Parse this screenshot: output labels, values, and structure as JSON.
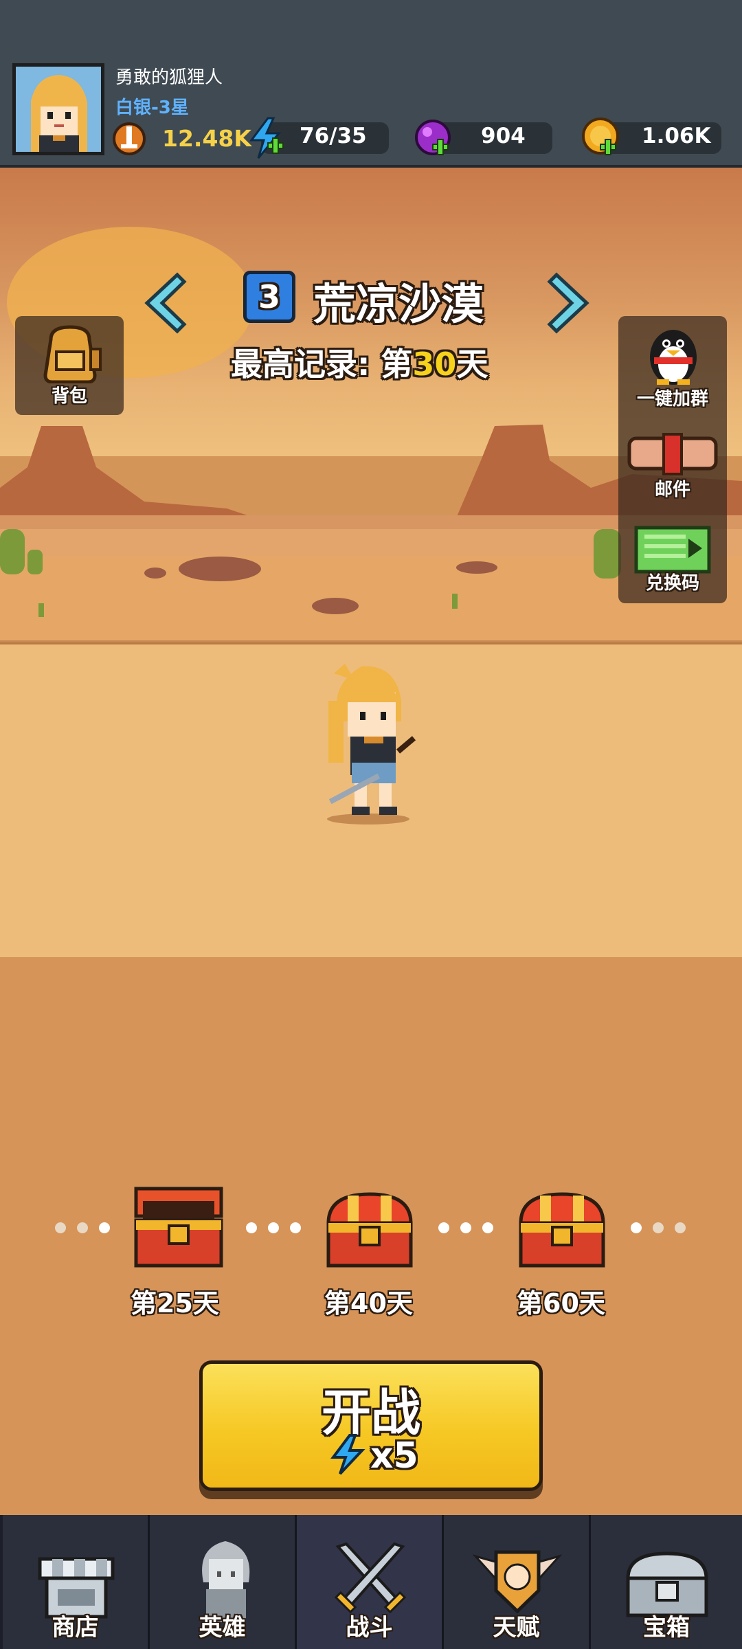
{
  "player": {
    "name": "勇敢的狐狸人",
    "rank": "白银-3星",
    "power": "12.48K"
  },
  "resources": {
    "energy": "76/35",
    "gems": "904",
    "coins": "1.06K"
  },
  "stage": {
    "number": "3",
    "name": "荒凉沙漠",
    "record_prefix": "最高记录: 第",
    "record_value": "30",
    "record_suffix": "天"
  },
  "side_buttons": {
    "backpack": "背包",
    "join_group": "一键加群",
    "mail": "邮件",
    "redeem": "兑换码"
  },
  "milestones": [
    {
      "label": "第25天"
    },
    {
      "label": "第40天"
    },
    {
      "label": "第60天"
    }
  ],
  "start_button": {
    "label": "开战",
    "cost": "x5"
  },
  "nav": {
    "shop": "商店",
    "heroes": "英雄",
    "battle": "战斗",
    "talent": "天赋",
    "chest": "宝箱"
  },
  "colors": {
    "record_highlight": "#f7d21c",
    "rank": "#5fb2ff",
    "power": "#f6d24a",
    "stage_badge": "#2f7fe0"
  }
}
